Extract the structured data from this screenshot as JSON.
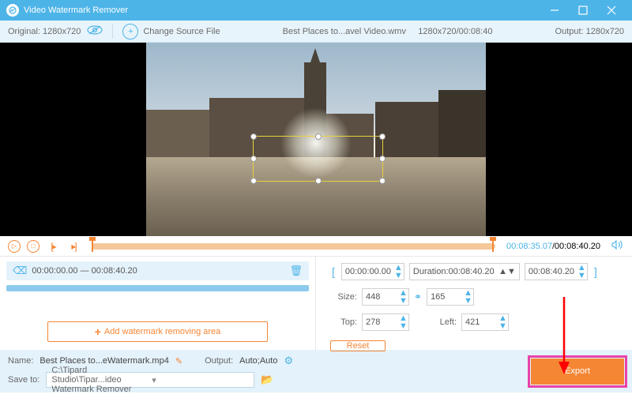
{
  "titlebar": {
    "title": "Video Watermark Remover"
  },
  "toolbar": {
    "original_label": "Original:",
    "original_res": "1280x720",
    "change_source": "Change Source File",
    "filename": "Best Places to...avel Video.wmv",
    "file_meta": "1280x720/00:08:40",
    "output_label": "Output:",
    "output_res": "1280x720"
  },
  "playback": {
    "current_time": "00:08:35.07",
    "total_time": "00:08:40.20"
  },
  "segment": {
    "range": "00:00:00.00 — 00:08:40.20"
  },
  "add_area_label": "Add watermark removing area",
  "timeset": {
    "start": "00:00:00.00",
    "duration_label": "Duration:",
    "duration": "00:08:40.20",
    "end": "00:08:40.20"
  },
  "size": {
    "label": "Size:",
    "w": "448",
    "h": "165"
  },
  "pos": {
    "top_label": "Top:",
    "top": "278",
    "left_label": "Left:",
    "left": "421"
  },
  "reset_label": "Reset",
  "bottom": {
    "name_label": "Name:",
    "name_val": "Best Places to...eWatermark.mp4",
    "output_label": "Output:",
    "output_val": "Auto;Auto",
    "saveto_label": "Save to:",
    "saveto_val": "C:\\Tipard Studio\\Tipar...ideo Watermark Remover"
  },
  "export_label": "Export"
}
